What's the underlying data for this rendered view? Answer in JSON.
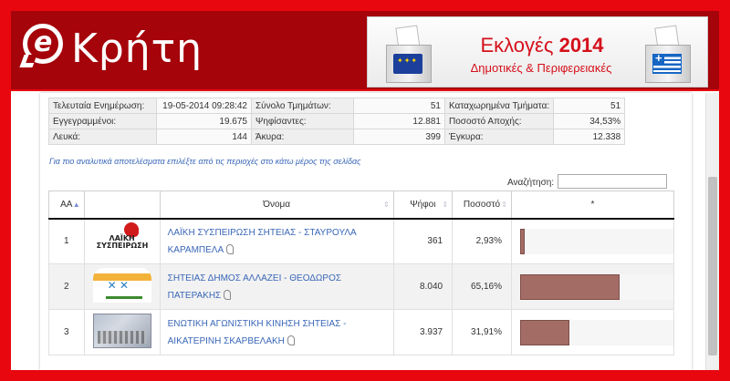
{
  "header": {
    "logo_letter": "e",
    "site_title": "Κρήτη",
    "banner": {
      "title_prefix": "Εκλογές ",
      "title_year": "2014",
      "subtitle": "Δημοτικές & Περιφερειακές"
    }
  },
  "summary": {
    "rows": [
      [
        {
          "label": "Τελευταία Ενημέρωση:",
          "value": "19-05-2014 09:28:42"
        },
        {
          "label": "Σύνολο Τμημάτων:",
          "value": "51"
        },
        {
          "label": "Καταχωρημένα Τμήματα:",
          "value": "51"
        }
      ],
      [
        {
          "label": "Εγγεγραμμένοι:",
          "value": "19.675"
        },
        {
          "label": "Ψηφίσαντες:",
          "value": "12.881"
        },
        {
          "label": "Ποσοστό Αποχής:",
          "value": "34,53%"
        }
      ],
      [
        {
          "label": "Λευκά:",
          "value": "144"
        },
        {
          "label": "Άκυρα:",
          "value": "399"
        },
        {
          "label": "Έγκυρα:",
          "value": "12.338"
        }
      ]
    ]
  },
  "note": "Για πιο αναλυτικά αποτελέσματα επιλέξτε από τις περιοχές στο κάτω μέρος της σελίδας",
  "search": {
    "label": "Αναζήτηση:",
    "value": ""
  },
  "table": {
    "headers": {
      "aa": "ΑΑ",
      "logo": "",
      "name": "Όνομα",
      "votes": "Ψήφοι",
      "pct": "Ποσοστό",
      "bar": "*"
    },
    "rows": [
      {
        "aa": "1",
        "logo": "laiki",
        "logo_text": "ΛΑΪΚΗ ΣΥΣΠΕΙΡΩΣΗ",
        "name_line1": "ΛΑΪΚΗ ΣΥΣΠΕΙΡΩΣΗ ΣΗΤΕΙΑΣ - ΣΤΑΥΡΟΥΛΑ",
        "name_line2": "ΚΑΡΑΜΠΕΛΑ",
        "votes": "361",
        "pct": "2,93%",
        "share": 2.93
      },
      {
        "aa": "2",
        "logo": "steias",
        "logo_text": "",
        "name_line1": "ΣΗΤΕΙΑΣ ΔΗΜΟΣ ΑΛΛΑΖΕΙ - ΘΕΟΔΩΡΟΣ",
        "name_line2": "ΠΑΤΕΡΑΚΗΣ",
        "votes": "8.040",
        "pct": "65,16%",
        "share": 65.16
      },
      {
        "aa": "3",
        "logo": "enotiki",
        "logo_text": "",
        "name_line1": "ΕΝΩΤΙΚΗ ΑΓΩΝΙΣΤΙΚΗ ΚΙΝΗΣΗ ΣΗΤΕΙΑΣ -",
        "name_line2": "ΑΙΚΑΤΕΡΙΝΗ ΣΚΑΡΒΕΛΑΚΗ",
        "votes": "3.937",
        "pct": "31,91%",
        "share": 31.91
      }
    ]
  },
  "colors": {
    "frame": "#e8070f",
    "header_bg": "#a5040a",
    "bar": "#a36d66",
    "link": "#3a67b8",
    "banner_text": "#d5101b"
  }
}
